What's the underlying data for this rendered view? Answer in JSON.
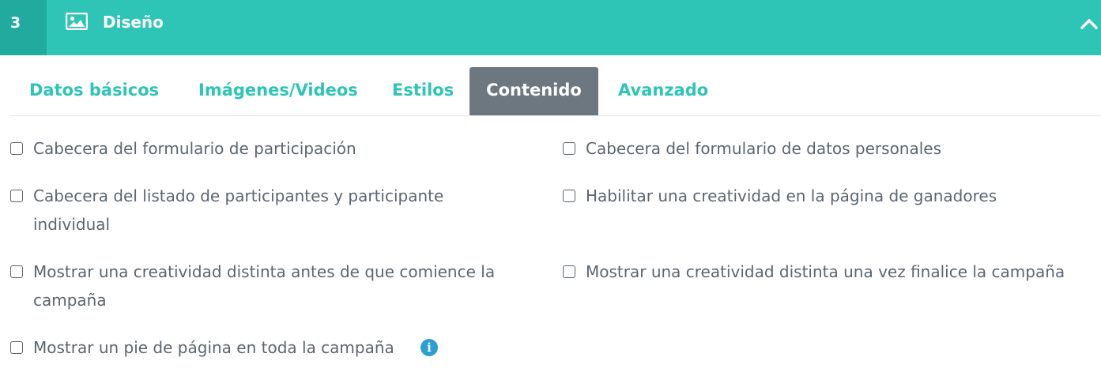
{
  "header": {
    "step_number": "3",
    "title": "Diseño",
    "icon": "image-icon",
    "collapse_icon": "chevron-up-icon",
    "background_color": "#2ec4b6"
  },
  "tabs": [
    {
      "label": "Datos básicos",
      "active": false
    },
    {
      "label": "Imágenes/Videos",
      "active": false
    },
    {
      "label": "Estilos",
      "active": false
    },
    {
      "label": "Contenido",
      "active": true
    },
    {
      "label": "Avanzado",
      "active": false
    }
  ],
  "options": [
    {
      "lines": [
        "Cabecera del formulario de participación"
      ],
      "checked": false
    },
    {
      "lines": [
        "Cabecera del formulario de datos personales"
      ],
      "checked": false
    },
    {
      "lines": [
        "Cabecera del listado de participantes y participante",
        "individual"
      ],
      "checked": false
    },
    {
      "lines": [
        "Habilitar una creatividad en la página de ganadores"
      ],
      "checked": false
    },
    {
      "lines": [
        "Mostrar una creatividad distinta antes de que comience la",
        "campaña"
      ],
      "checked": false
    },
    {
      "lines": [
        "Mostrar una creatividad distinta una vez finalice la campaña"
      ],
      "checked": false
    },
    {
      "lines": [
        "Mostrar un pie de página en toda la campaña"
      ],
      "checked": false,
      "info_icon": "info-icon"
    }
  ],
  "info_glyph": "i"
}
